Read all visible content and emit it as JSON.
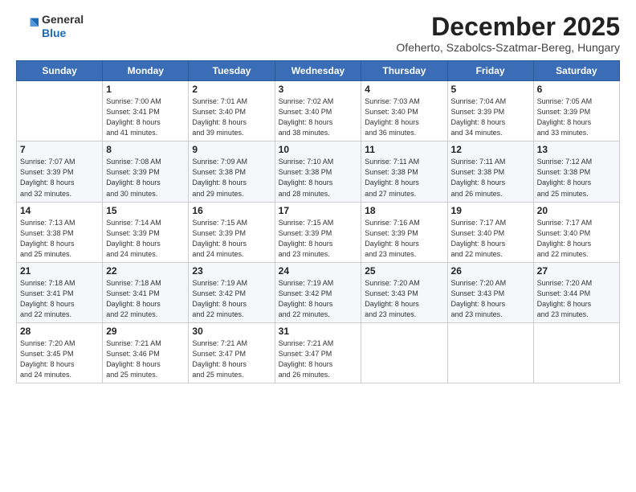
{
  "header": {
    "logo_line1": "General",
    "logo_line2": "Blue",
    "month_title": "December 2025",
    "location": "Ofeherto, Szabolcs-Szatmar-Bereg, Hungary"
  },
  "days_of_week": [
    "Sunday",
    "Monday",
    "Tuesday",
    "Wednesday",
    "Thursday",
    "Friday",
    "Saturday"
  ],
  "weeks": [
    [
      {
        "day": "",
        "info": ""
      },
      {
        "day": "1",
        "info": "Sunrise: 7:00 AM\nSunset: 3:41 PM\nDaylight: 8 hours\nand 41 minutes."
      },
      {
        "day": "2",
        "info": "Sunrise: 7:01 AM\nSunset: 3:40 PM\nDaylight: 8 hours\nand 39 minutes."
      },
      {
        "day": "3",
        "info": "Sunrise: 7:02 AM\nSunset: 3:40 PM\nDaylight: 8 hours\nand 38 minutes."
      },
      {
        "day": "4",
        "info": "Sunrise: 7:03 AM\nSunset: 3:40 PM\nDaylight: 8 hours\nand 36 minutes."
      },
      {
        "day": "5",
        "info": "Sunrise: 7:04 AM\nSunset: 3:39 PM\nDaylight: 8 hours\nand 34 minutes."
      },
      {
        "day": "6",
        "info": "Sunrise: 7:05 AM\nSunset: 3:39 PM\nDaylight: 8 hours\nand 33 minutes."
      }
    ],
    [
      {
        "day": "7",
        "info": "Sunrise: 7:07 AM\nSunset: 3:39 PM\nDaylight: 8 hours\nand 32 minutes."
      },
      {
        "day": "8",
        "info": "Sunrise: 7:08 AM\nSunset: 3:39 PM\nDaylight: 8 hours\nand 30 minutes."
      },
      {
        "day": "9",
        "info": "Sunrise: 7:09 AM\nSunset: 3:38 PM\nDaylight: 8 hours\nand 29 minutes."
      },
      {
        "day": "10",
        "info": "Sunrise: 7:10 AM\nSunset: 3:38 PM\nDaylight: 8 hours\nand 28 minutes."
      },
      {
        "day": "11",
        "info": "Sunrise: 7:11 AM\nSunset: 3:38 PM\nDaylight: 8 hours\nand 27 minutes."
      },
      {
        "day": "12",
        "info": "Sunrise: 7:11 AM\nSunset: 3:38 PM\nDaylight: 8 hours\nand 26 minutes."
      },
      {
        "day": "13",
        "info": "Sunrise: 7:12 AM\nSunset: 3:38 PM\nDaylight: 8 hours\nand 25 minutes."
      }
    ],
    [
      {
        "day": "14",
        "info": "Sunrise: 7:13 AM\nSunset: 3:38 PM\nDaylight: 8 hours\nand 25 minutes."
      },
      {
        "day": "15",
        "info": "Sunrise: 7:14 AM\nSunset: 3:39 PM\nDaylight: 8 hours\nand 24 minutes."
      },
      {
        "day": "16",
        "info": "Sunrise: 7:15 AM\nSunset: 3:39 PM\nDaylight: 8 hours\nand 24 minutes."
      },
      {
        "day": "17",
        "info": "Sunrise: 7:15 AM\nSunset: 3:39 PM\nDaylight: 8 hours\nand 23 minutes."
      },
      {
        "day": "18",
        "info": "Sunrise: 7:16 AM\nSunset: 3:39 PM\nDaylight: 8 hours\nand 23 minutes."
      },
      {
        "day": "19",
        "info": "Sunrise: 7:17 AM\nSunset: 3:40 PM\nDaylight: 8 hours\nand 22 minutes."
      },
      {
        "day": "20",
        "info": "Sunrise: 7:17 AM\nSunset: 3:40 PM\nDaylight: 8 hours\nand 22 minutes."
      }
    ],
    [
      {
        "day": "21",
        "info": "Sunrise: 7:18 AM\nSunset: 3:41 PM\nDaylight: 8 hours\nand 22 minutes."
      },
      {
        "day": "22",
        "info": "Sunrise: 7:18 AM\nSunset: 3:41 PM\nDaylight: 8 hours\nand 22 minutes."
      },
      {
        "day": "23",
        "info": "Sunrise: 7:19 AM\nSunset: 3:42 PM\nDaylight: 8 hours\nand 22 minutes."
      },
      {
        "day": "24",
        "info": "Sunrise: 7:19 AM\nSunset: 3:42 PM\nDaylight: 8 hours\nand 22 minutes."
      },
      {
        "day": "25",
        "info": "Sunrise: 7:20 AM\nSunset: 3:43 PM\nDaylight: 8 hours\nand 23 minutes."
      },
      {
        "day": "26",
        "info": "Sunrise: 7:20 AM\nSunset: 3:43 PM\nDaylight: 8 hours\nand 23 minutes."
      },
      {
        "day": "27",
        "info": "Sunrise: 7:20 AM\nSunset: 3:44 PM\nDaylight: 8 hours\nand 23 minutes."
      }
    ],
    [
      {
        "day": "28",
        "info": "Sunrise: 7:20 AM\nSunset: 3:45 PM\nDaylight: 8 hours\nand 24 minutes."
      },
      {
        "day": "29",
        "info": "Sunrise: 7:21 AM\nSunset: 3:46 PM\nDaylight: 8 hours\nand 25 minutes."
      },
      {
        "day": "30",
        "info": "Sunrise: 7:21 AM\nSunset: 3:47 PM\nDaylight: 8 hours\nand 25 minutes."
      },
      {
        "day": "31",
        "info": "Sunrise: 7:21 AM\nSunset: 3:47 PM\nDaylight: 8 hours\nand 26 minutes."
      },
      {
        "day": "",
        "info": ""
      },
      {
        "day": "",
        "info": ""
      },
      {
        "day": "",
        "info": ""
      }
    ]
  ]
}
